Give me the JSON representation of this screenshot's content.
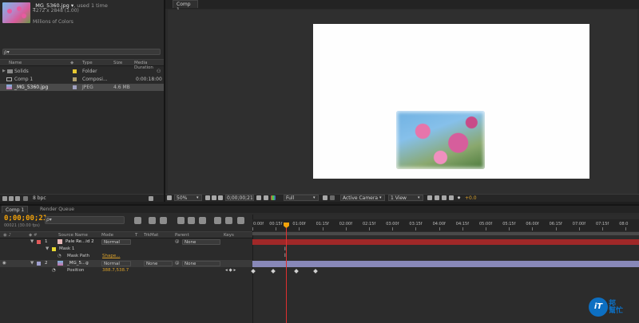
{
  "project": {
    "file_name": "_MG_5360.jpg ▾",
    "used": ", used 1 time",
    "dimensions": "4272 x 2848 (1.00)",
    "colors": "Millions of Colors",
    "search_placeholder": "ρ▾",
    "columns": [
      "Name",
      "Type",
      "Size",
      "Media Duration"
    ],
    "items": [
      {
        "name": "Solids",
        "type": "Folder",
        "size": "",
        "duration": "",
        "color": "#e8c830"
      },
      {
        "name": "Comp 1",
        "type": "Composi...",
        "size": "",
        "duration": "0:00:18:00",
        "color": "#b0a070"
      },
      {
        "name": "_MG_5360.jpg",
        "type": "JPEG",
        "size": "4.6 MB",
        "duration": "",
        "color": "#a0a0c0"
      }
    ],
    "bpc": "8 bpc"
  },
  "comp": {
    "tab": "Comp 1",
    "zoom": "50%",
    "timecode": "0;00;00;21",
    "resolution": "Full",
    "camera": "Active Camera",
    "view": "1 View",
    "exposure": "+0.0"
  },
  "timeline": {
    "tab_comp": "Comp 1",
    "tab_render": "Render Queue",
    "timecode": "0;00;00;21",
    "fps": "00021 (30.00 fps)",
    "search_placeholder": "ρ▾",
    "columns": {
      "source": "Source Name",
      "mode": "Mode",
      "t": "T",
      "trkmat": "TrkMat",
      "parent": "Parent",
      "keys": "Keys"
    },
    "ruler": [
      "0:00f",
      "00:15f",
      "01:00f",
      "01:15f",
      "02:00f",
      "02:15f",
      "03:00f",
      "03:15f",
      "04:00f",
      "04:15f",
      "05:00f",
      "05:15f",
      "06:00f",
      "06:15f",
      "07:00f",
      "07:15f",
      "08:0"
    ],
    "layers": [
      {
        "num": "1",
        "name": "Pale Re...id 2",
        "mode": "Normal",
        "parent": "None",
        "color": "#e25a5a"
      },
      {
        "num": "2",
        "name": "_MG_5...g",
        "mode": "Normal",
        "trkmat": "None",
        "parent": "None",
        "color": "#a0a0d0"
      }
    ],
    "mask_label": "Mask 1",
    "mask_path_label": "Mask Path",
    "mask_path_value": "Shape...",
    "position_label": "Position",
    "position_value": "388.7,538.7"
  },
  "watermark": {
    "logo": "iT",
    "text1": "邦",
    "text2": "幫忙"
  }
}
